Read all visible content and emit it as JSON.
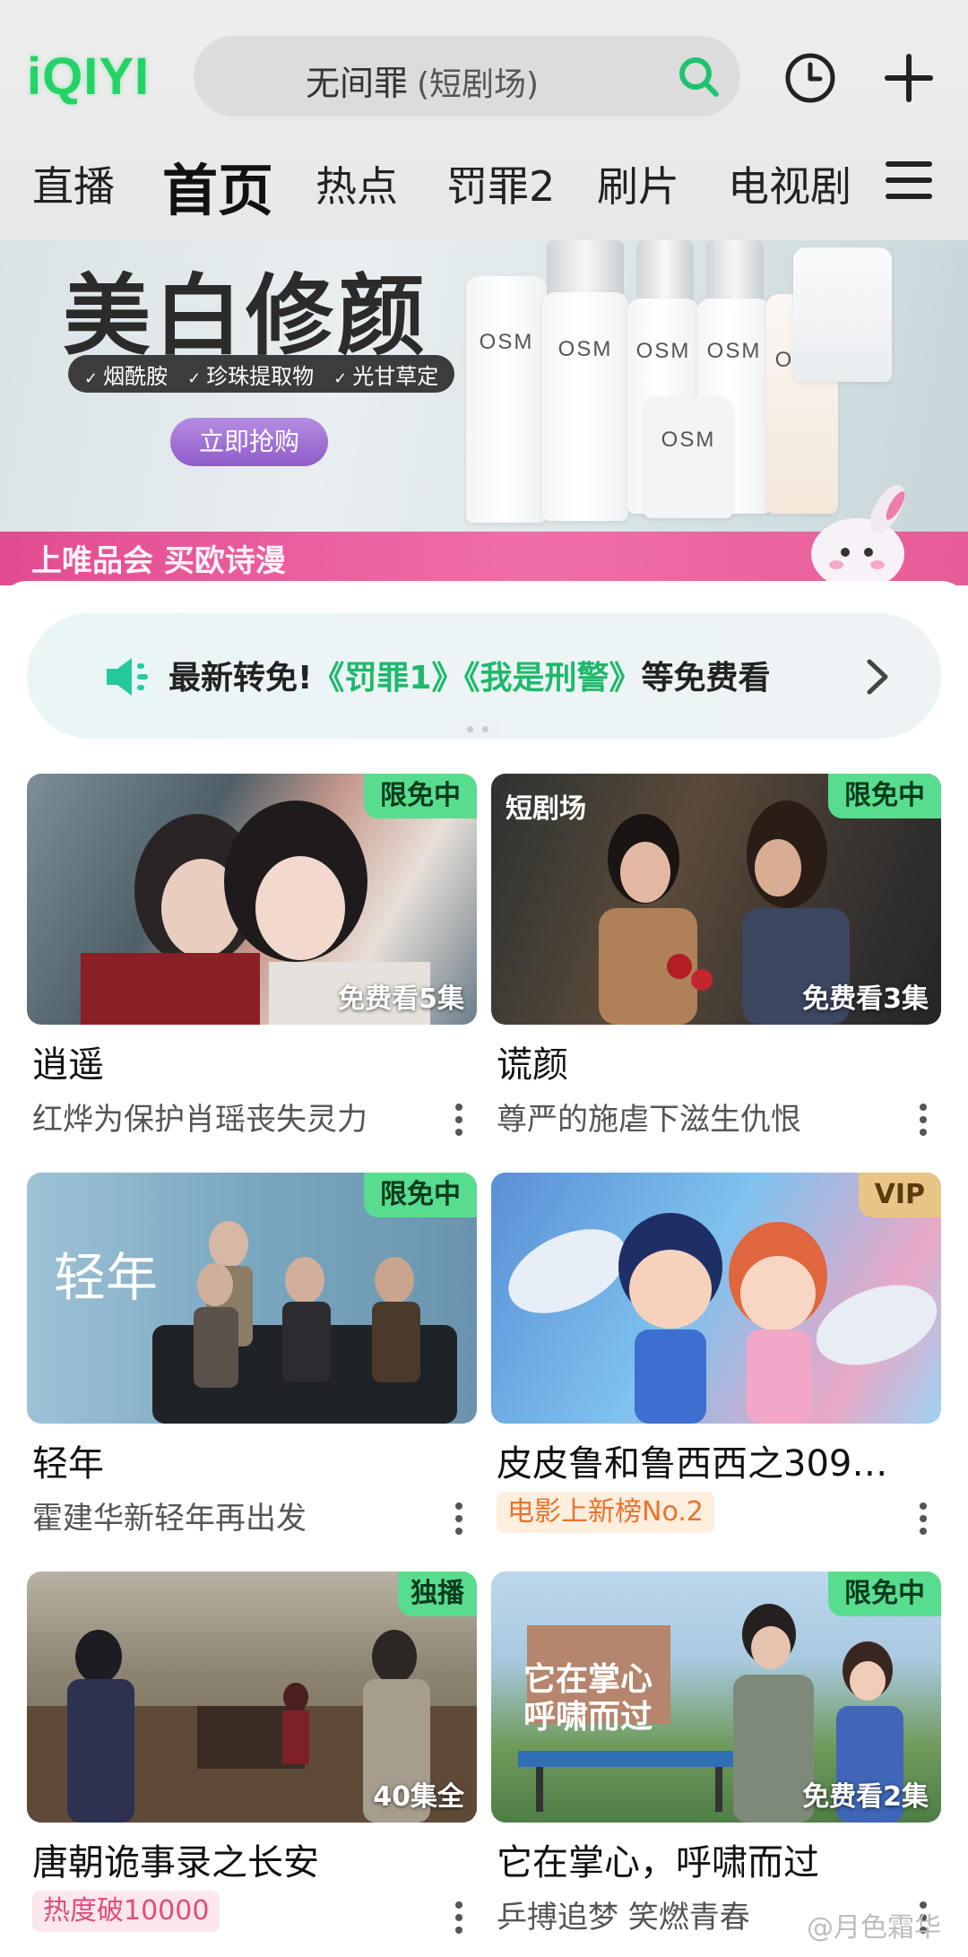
{
  "header": {
    "logo": "iQIYI",
    "search": {
      "query": "无间罪",
      "tag": "(短剧场)"
    },
    "tabs": [
      {
        "label": "直播",
        "active": false
      },
      {
        "label": "首页",
        "active": true
      },
      {
        "label": "热点",
        "active": false
      },
      {
        "label": "罚罪2",
        "active": false
      },
      {
        "label": "刷片",
        "active": false
      },
      {
        "label": "电视剧",
        "active": false
      }
    ]
  },
  "banner": {
    "title": "美白修颜",
    "tags": [
      "烟酰胺",
      "珍珠提取物",
      "光甘草定"
    ],
    "button": "立即抢购",
    "brand": "OSM",
    "footer": "上唯品会 买欧诗漫"
  },
  "notice": {
    "prefix": "最新转免!",
    "highlight": "《罚罪1》《我是刑警》",
    "suffix": "等免费看"
  },
  "cards": [
    {
      "title": "逍遥",
      "badge": "限免中",
      "overlay": "免费看5集",
      "desc": "红烨为保护肖瑶丧失灵力"
    },
    {
      "title": "谎颜",
      "badge": "限免中",
      "overlay": "免费看3集",
      "desc": "尊严的施虐下滋生仇恨",
      "channel": "短剧场"
    },
    {
      "title": "轻年",
      "badge": "限免中",
      "overlay": "",
      "desc": "霍建华新轻年再出发",
      "logo": "轻年"
    },
    {
      "title": "皮皮鲁和鲁西西之309…",
      "badge": "VIP",
      "overlay": "",
      "tag": "电影上新榜No.2"
    },
    {
      "title": "唐朝诡事录之长安",
      "badge": "独播",
      "overlay": "40集全",
      "tag": "热度破10000"
    },
    {
      "title": "它在掌心，呼啸而过",
      "badge": "限免中",
      "overlay": "免费看2集",
      "desc": "乒搏追梦 笑燃青春",
      "logo": "它在掌心 呼啸而过"
    }
  ],
  "watermark": "@月色霜华",
  "colors": {
    "brand": "#23d366",
    "badge_free": "#58dd8f",
    "badge_vip": "#e8c586",
    "notice_highlight": "#1fb86a"
  },
  "icons": [
    "search-icon",
    "clock-icon",
    "plus-icon",
    "menu-icon",
    "speaker-icon",
    "chevron-right-icon",
    "more-icon"
  ]
}
